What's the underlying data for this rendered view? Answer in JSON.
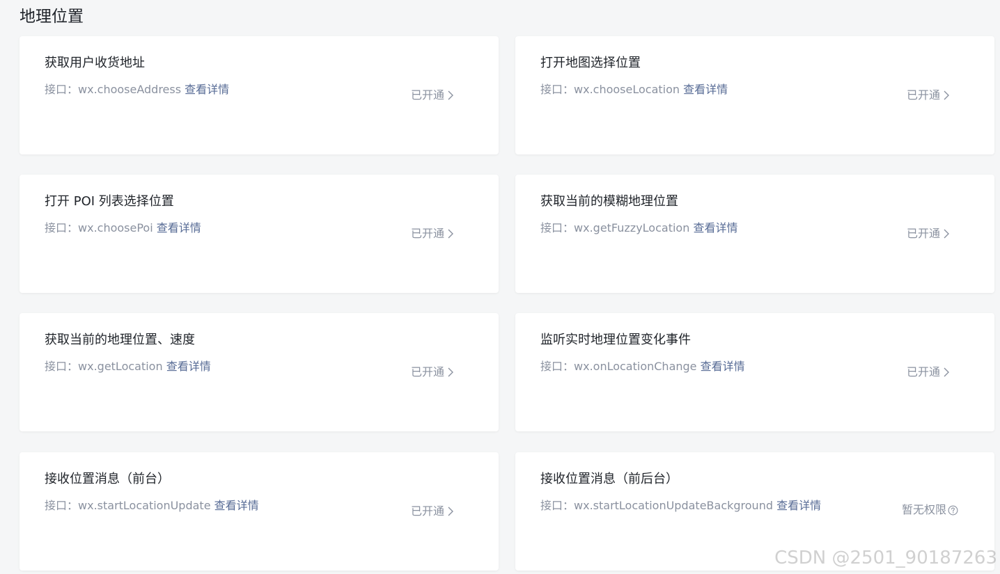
{
  "section": {
    "title": "地理位置"
  },
  "cards": [
    {
      "title": "获取用户收货地址",
      "api_prefix": "接口：",
      "api": "wx.chooseAddress",
      "link": "查看详情",
      "status": "已开通"
    },
    {
      "title": "打开地图选择位置",
      "api_prefix": "接口：",
      "api": "wx.chooseLocation",
      "link": "查看详情",
      "status": "已开通"
    },
    {
      "title": "打开 POI 列表选择位置",
      "api_prefix": "接口：",
      "api": "wx.choosePoi",
      "link": "查看详情",
      "status": "已开通"
    },
    {
      "title": "获取当前的模糊地理位置",
      "api_prefix": "接口：",
      "api": "wx.getFuzzyLocation",
      "link": "查看详情",
      "status": "已开通"
    },
    {
      "title": "获取当前的地理位置、速度",
      "api_prefix": "接口：",
      "api": "wx.getLocation",
      "link": "查看详情",
      "status": "已开通"
    },
    {
      "title": "监听实时地理位置变化事件",
      "api_prefix": "接口：",
      "api": "wx.onLocationChange",
      "link": "查看详情",
      "status": "已开通"
    },
    {
      "title": "接收位置消息（前台）",
      "api_prefix": "接口：",
      "api": "wx.startLocationUpdate",
      "link": "查看详情",
      "status": "已开通"
    },
    {
      "title": "接收位置消息（前后台）",
      "api_prefix": "接口：",
      "api": "wx.startLocationUpdateBackground",
      "link": "查看详情",
      "status": "暂无权限"
    }
  ],
  "icons": {
    "status_arrow": "chevron-right-icon",
    "help": "question-circle-icon"
  },
  "colors": {
    "link": "#576b95",
    "muted": "#8a919f",
    "title": "#1f2329",
    "background": "#f5f6f7"
  },
  "watermark": "CSDN @2501_90187263"
}
